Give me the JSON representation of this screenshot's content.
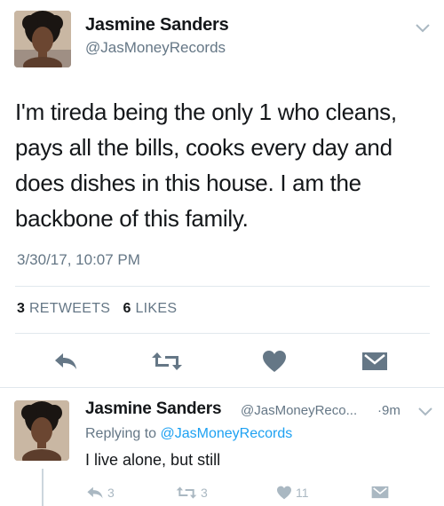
{
  "main_tweet": {
    "name": "Jasmine Sanders",
    "handle": "@JasMoneyRecords",
    "text_lines": [
      "I'm tireda being the only 1 who cleans,",
      "pays all the bills, cooks every day and",
      "does dishes in this house. I am the",
      "backbone of this family."
    ],
    "timestamp": "3/30/17, 10:07 PM",
    "retweets_count": "3",
    "retweets_label": "RETWEETS",
    "likes_count": "6",
    "likes_label": "LIKES",
    "icons": [
      "chevron-down-icon",
      "reply-icon",
      "retweet-icon",
      "heart-icon",
      "dm-icon"
    ]
  },
  "reply_tweet": {
    "name": "Jasmine Sanders",
    "handle": "@JasMoneyReco...",
    "separator": "·",
    "time": "9m",
    "replying_prefix": "Replying to",
    "replying_handle": "@JasMoneyRecords",
    "text": "I live alone, but still",
    "reply_count": "3",
    "retweet_count": "3",
    "like_count": "11"
  },
  "colors": {
    "text": "#14171a",
    "secondary": "#657786",
    "link": "#1da1f2",
    "icon": "#657786",
    "icon_light": "#aab8c2",
    "divider": "#e1e8ed"
  }
}
